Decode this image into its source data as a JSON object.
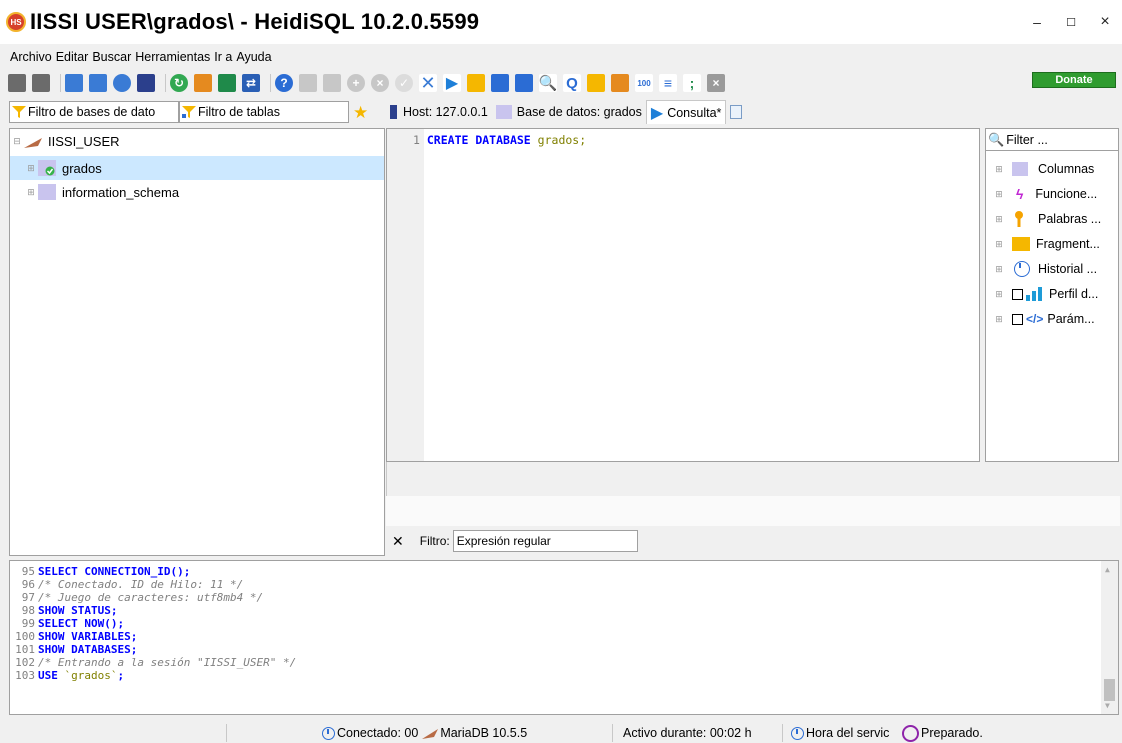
{
  "window": {
    "title": "IISSI  USER\\grados\\ - HeidiSQL 10.2.0.5599",
    "logo_text": "HS",
    "minimize": "–",
    "maximize": "☐",
    "close": "×"
  },
  "menu": [
    "Archivo",
    "Editar",
    "Buscar",
    "Herramientas",
    "Ir a",
    "Ayuda"
  ],
  "toolbar": {
    "donate_label": "Donate"
  },
  "filters": {
    "db_filter": "Filtro de bases de dato",
    "table_filter": "Filtro de tablas"
  },
  "tabs": [
    {
      "label": "Host: 127.0.0.1"
    },
    {
      "label": "Base de datos: grados"
    },
    {
      "label": "Consulta*"
    }
  ],
  "tree": {
    "session": "IISSI_USER",
    "databases": [
      "grados",
      "information_schema"
    ]
  },
  "editor": {
    "line_number": "1",
    "keywords": "CREATE DATABASE",
    "identifier": "grados",
    "terminator": ";"
  },
  "helpers": {
    "filter_placeholder": "Filter ...",
    "items": [
      "Columnas",
      "Funcione...",
      "Palabras ...",
      "Fragment...",
      "Historial ...",
      "Perfil d...",
      "Parám..."
    ]
  },
  "result_filter": {
    "label": "Filtro:",
    "value": "Expresión regular"
  },
  "log": [
    {
      "n": "95",
      "kw": "SELECT CONNECTION_ID();",
      "comment": ""
    },
    {
      "n": "96",
      "kw": "",
      "comment": "/* Conectado. ID de Hilo: 11 */"
    },
    {
      "n": "97",
      "kw": "",
      "comment": "/* Juego de caracteres: utf8mb4 */"
    },
    {
      "n": "98",
      "kw": "SHOW STATUS;",
      "comment": ""
    },
    {
      "n": "99",
      "kw": "SELECT NOW();",
      "comment": ""
    },
    {
      "n": "100",
      "kw": "SHOW VARIABLES;",
      "comment": ""
    },
    {
      "n": "101",
      "kw": "SHOW DATABASES;",
      "comment": ""
    },
    {
      "n": "102",
      "kw": "",
      "comment": "/* Entrando a la sesión \"IISSI_USER\" */"
    },
    {
      "n": "103",
      "kw": "USE",
      "ident": "`grados`",
      "tail": ";",
      "comment": ""
    }
  ],
  "status": {
    "connected": "Conectado: 00",
    "server": "MariaDB 10.5.5",
    "uptime": "Activo durante: 00:02 h",
    "server_time": "Hora del servic",
    "state": "Preparado."
  },
  "colors": {
    "selection": "#cce8ff",
    "keyword": "#0000ff",
    "identifier": "#808000",
    "comment": "#808080",
    "donate": "#2f9c2f"
  }
}
